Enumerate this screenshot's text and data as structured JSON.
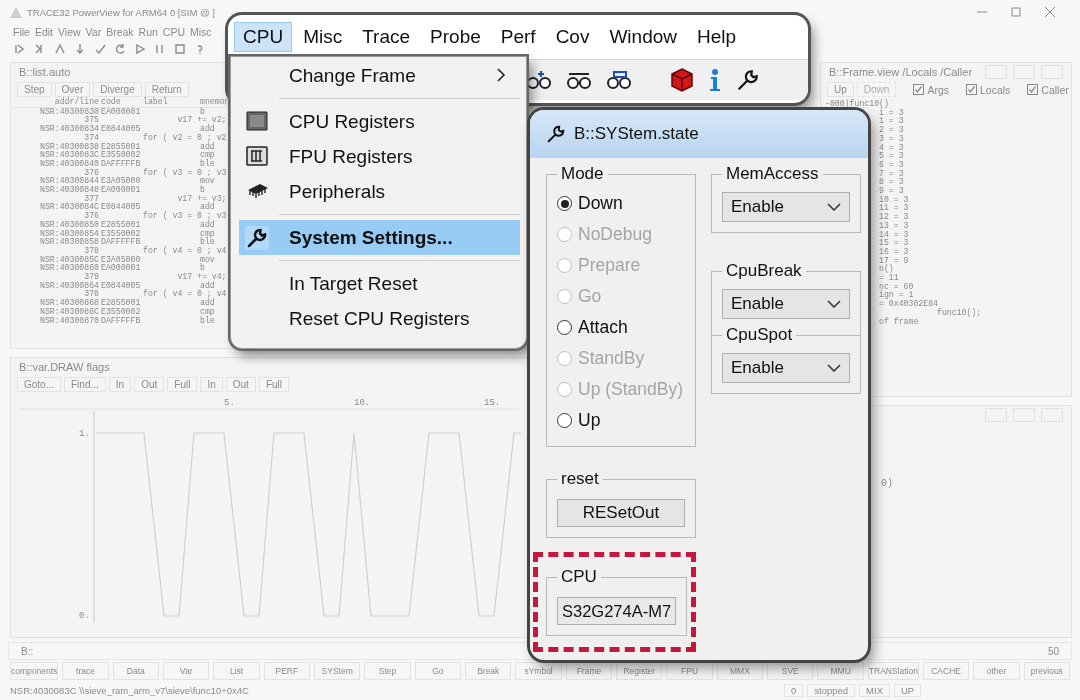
{
  "app": {
    "title": "TRACE32 PowerView for ARM64 0 [SIM @ ]",
    "menu": [
      "File",
      "Edit",
      "View",
      "Var",
      "Break",
      "Run",
      "CPU",
      "Misc"
    ]
  },
  "list_window": {
    "title": "B::list.auto",
    "buttons": [
      "Step",
      "Over",
      "Diverge",
      "Return"
    ],
    "columns": [
      "addr/line",
      "code",
      "label",
      "mnemon"
    ],
    "rows": [
      {
        "kind": "asm",
        "addr": "NSR:40300830",
        "code": "EA000001",
        "mnemonic": "b"
      },
      {
        "kind": "source",
        "line": "375",
        "text": "       v17 += v2;"
      },
      {
        "kind": "asm",
        "addr": "NSR:40300834",
        "code": "E0844005",
        "mnemonic": "add"
      },
      {
        "kind": "source",
        "line": "374",
        "text": "for ( v2 = 0 ; v2"
      },
      {
        "kind": "asm",
        "addr": "NSR:40300838",
        "code": "E2855001",
        "mnemonic": "add"
      },
      {
        "kind": "asm",
        "addr": "NSR:4030083C",
        "code": "E3550002",
        "mnemonic": "cmp"
      },
      {
        "kind": "asm",
        "addr": "NSR:40300840",
        "code": "DAFFFFFB",
        "mnemonic": "ble"
      },
      {
        "kind": "source",
        "line": "376",
        "text": "for ( v3 = 0 ; v3"
      },
      {
        "kind": "asm",
        "addr": "NSR:40300844",
        "code": "E3A05000",
        "mnemonic": "mov"
      },
      {
        "kind": "asm",
        "addr": "NSR:40300848",
        "code": "EA000001",
        "mnemonic": "b"
      },
      {
        "kind": "source",
        "line": "377",
        "text": "       v17 += v3;"
      },
      {
        "kind": "asm",
        "addr": "NSR:4030084C",
        "code": "E0844005",
        "mnemonic": "add"
      },
      {
        "kind": "source",
        "line": "376",
        "text": "for ( v3 = 0 ; v3"
      },
      {
        "kind": "asm",
        "addr": "NSR:40300850",
        "code": "E2855001",
        "mnemonic": "add"
      },
      {
        "kind": "asm",
        "addr": "NSR:40300854",
        "code": "E3550002",
        "mnemonic": "cmp"
      },
      {
        "kind": "asm",
        "addr": "NSR:40300858",
        "code": "DAFFFFFB",
        "mnemonic": "ble"
      },
      {
        "kind": "source",
        "line": "378",
        "text": "for ( v4 = 0 ; v4"
      },
      {
        "kind": "asm",
        "addr": "NSR:4030085C",
        "code": "E3A05000",
        "mnemonic": "mov"
      },
      {
        "kind": "asm",
        "addr": "NSR:40300860",
        "code": "EA000001",
        "mnemonic": "b"
      },
      {
        "kind": "source",
        "line": "379",
        "text": "       v17 += v4;"
      },
      {
        "kind": "asm",
        "addr": "NSR:40300864",
        "code": "E0844005",
        "mnemonic": "add"
      },
      {
        "kind": "source",
        "line": "378",
        "text": "for ( v4 = 0 ; v4"
      },
      {
        "kind": "asm",
        "addr": "NSR:40300868",
        "code": "E2855001",
        "mnemonic": "add"
      },
      {
        "kind": "asm",
        "addr": "NSR:4030086C",
        "code": "E3550002",
        "mnemonic": "cmp"
      },
      {
        "kind": "asm",
        "addr": "NSR:40300870",
        "code": "DAFFFFFB",
        "mnemonic": "ble"
      }
    ]
  },
  "frame_window": {
    "title": "B::Frame.view /Locals /Caller",
    "buttons": [
      {
        "label": "Up",
        "disabled": false
      },
      {
        "label": "Down",
        "disabled": true
      }
    ],
    "options": [
      {
        "label": "Args",
        "checked": true
      },
      {
        "label": "Locals",
        "checked": true
      },
      {
        "label": "Caller",
        "checked": true
      }
    ],
    "lines": [
      {
        "kind": "frame",
        "text": "-000|func10()"
      },
      {
        "kind": "local",
        "text": "i = 3"
      },
      {
        "kind": "local",
        "text": "1 = 3"
      },
      {
        "kind": "local",
        "text": "2 = 3"
      },
      {
        "kind": "local",
        "text": "3 = 3"
      },
      {
        "kind": "local",
        "text": "4 = 3"
      },
      {
        "kind": "local",
        "text": "5 = 3"
      },
      {
        "kind": "local",
        "text": "6 = 3"
      },
      {
        "kind": "local",
        "text": "7 = 3"
      },
      {
        "kind": "local",
        "text": "8 = 3"
      },
      {
        "kind": "local",
        "text": "9 = 3"
      },
      {
        "kind": "local",
        "text": "10 = 3"
      },
      {
        "kind": "local",
        "text": "11 = 3"
      },
      {
        "kind": "local",
        "text": "12 = 3"
      },
      {
        "kind": "local",
        "text": "13 = 3"
      },
      {
        "kind": "local",
        "text": "14 = 3"
      },
      {
        "kind": "local",
        "text": "15 = 3"
      },
      {
        "kind": "local",
        "text": "16 = 3"
      },
      {
        "kind": "local",
        "text": "17 = 9"
      },
      {
        "kind": "local",
        "text": "n()"
      },
      {
        "kind": "local",
        "text": "= 11"
      },
      {
        "kind": "local",
        "text": "nc = 60"
      },
      {
        "kind": "local",
        "text": "ign = 1"
      },
      {
        "kind": "local",
        "text": "= 0x40302E84"
      },
      {
        "kind": "source",
        "text": "func10();"
      },
      {
        "kind": "local",
        "text": "of frame"
      }
    ]
  },
  "draw_window": {
    "title": "B::var.DRAW flags",
    "buttons": [
      "Goto...",
      "Find...",
      "In",
      "Out",
      "Full",
      "In",
      "Out",
      "Full"
    ],
    "x_labels": [
      "5.",
      "10.",
      "15."
    ],
    "y_labels": [
      "1.",
      "0."
    ]
  },
  "side_window": {
    "lines": [
      "0)"
    ]
  },
  "command_line": {
    "prompt": "B::",
    "counter": "50"
  },
  "softkeys": [
    "components",
    "trace",
    "Data",
    "Var",
    "List",
    "PERF",
    "SYStem",
    "Step",
    "Go",
    "Break",
    "sYmbol",
    "Frame",
    "Register",
    "FPU",
    "MMX",
    "SVE",
    "MMU",
    "TRANSlation",
    "CACHE",
    "other",
    "previous"
  ],
  "status": {
    "location": "NSR:4030083C  \\\\sieve_ram_arm_v7\\sieve\\func10+0x4C",
    "fields": [
      "0",
      "stopped",
      "MIX",
      "UP"
    ]
  },
  "cpu_menu": {
    "menu": [
      {
        "label": "CPU",
        "selected": true
      },
      {
        "label": "Misc",
        "selected": false
      },
      {
        "label": "Trace",
        "selected": false
      },
      {
        "label": "Probe",
        "selected": false
      },
      {
        "label": "Perf",
        "selected": false
      },
      {
        "label": "Cov",
        "selected": false
      },
      {
        "label": "Window",
        "selected": false
      },
      {
        "label": "Help",
        "selected": false
      }
    ],
    "items": [
      {
        "kind": "submenu",
        "label": "Change Frame",
        "selected": false
      },
      {
        "kind": "separator"
      },
      {
        "kind": "item",
        "label": "CPU Registers",
        "selected": false
      },
      {
        "kind": "item",
        "label": "FPU Registers",
        "selected": false
      },
      {
        "kind": "item",
        "label": "Peripherals",
        "selected": false
      },
      {
        "kind": "separator"
      },
      {
        "kind": "item",
        "label": "System Settings...",
        "selected": true
      },
      {
        "kind": "separator"
      },
      {
        "kind": "item",
        "label": "In Target Reset",
        "selected": false
      },
      {
        "kind": "item",
        "label": "Reset CPU Registers",
        "selected": false
      }
    ]
  },
  "dialog": {
    "title": "B::SYStem.state",
    "mode": {
      "label": "Mode",
      "options": [
        {
          "label": "Down",
          "selected": true,
          "disabled": false
        },
        {
          "label": "NoDebug",
          "selected": false,
          "disabled": true
        },
        {
          "label": "Prepare",
          "selected": false,
          "disabled": true
        },
        {
          "label": "Go",
          "selected": false,
          "disabled": true
        },
        {
          "label": "Attach",
          "selected": false,
          "disabled": false
        },
        {
          "label": "StandBy",
          "selected": false,
          "disabled": true
        },
        {
          "label": "Up (StandBy)",
          "selected": false,
          "disabled": true
        },
        {
          "label": "Up",
          "selected": false,
          "disabled": false
        }
      ]
    },
    "mem_access": {
      "label": "MemAccess",
      "value": "Enable"
    },
    "cpu_break": {
      "label": "CpuBreak",
      "value": "Enable"
    },
    "cpu_spot": {
      "label": "CpuSpot",
      "value": "Enable"
    },
    "reset": {
      "label": "reset",
      "button": "RESetOut"
    },
    "cpu": {
      "label": "CPU",
      "value": "S32G274A-M7",
      "highlighted": true
    }
  }
}
